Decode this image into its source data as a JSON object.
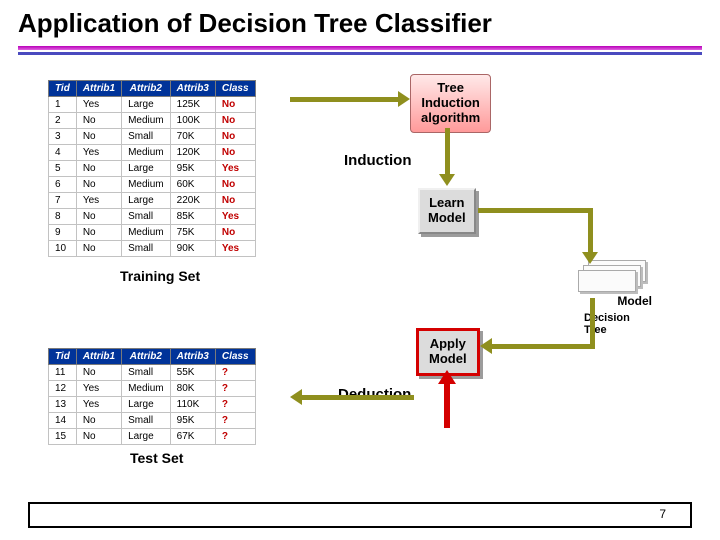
{
  "title": "Application of Decision Tree Classifier",
  "training": {
    "label": "Training Set",
    "headers": [
      "Tid",
      "Attrib1",
      "Attrib2",
      "Attrib3",
      "Class"
    ],
    "rows": [
      {
        "tid": "1",
        "a1": "Yes",
        "a2": "Large",
        "a3": "125K",
        "cls": "No"
      },
      {
        "tid": "2",
        "a1": "No",
        "a2": "Medium",
        "a3": "100K",
        "cls": "No"
      },
      {
        "tid": "3",
        "a1": "No",
        "a2": "Small",
        "a3": "70K",
        "cls": "No"
      },
      {
        "tid": "4",
        "a1": "Yes",
        "a2": "Medium",
        "a3": "120K",
        "cls": "No"
      },
      {
        "tid": "5",
        "a1": "No",
        "a2": "Large",
        "a3": "95K",
        "cls": "Yes"
      },
      {
        "tid": "6",
        "a1": "No",
        "a2": "Medium",
        "a3": "60K",
        "cls": "No"
      },
      {
        "tid": "7",
        "a1": "Yes",
        "a2": "Large",
        "a3": "220K",
        "cls": "No"
      },
      {
        "tid": "8",
        "a1": "No",
        "a2": "Small",
        "a3": "85K",
        "cls": "Yes"
      },
      {
        "tid": "9",
        "a1": "No",
        "a2": "Medium",
        "a3": "75K",
        "cls": "No"
      },
      {
        "tid": "10",
        "a1": "No",
        "a2": "Small",
        "a3": "90K",
        "cls": "Yes"
      }
    ]
  },
  "test": {
    "label": "Test Set",
    "headers": [
      "Tid",
      "Attrib1",
      "Attrib2",
      "Attrib3",
      "Class"
    ],
    "rows": [
      {
        "tid": "11",
        "a1": "No",
        "a2": "Small",
        "a3": "55K",
        "cls": "?"
      },
      {
        "tid": "12",
        "a1": "Yes",
        "a2": "Medium",
        "a3": "80K",
        "cls": "?"
      },
      {
        "tid": "13",
        "a1": "Yes",
        "a2": "Large",
        "a3": "110K",
        "cls": "?"
      },
      {
        "tid": "14",
        "a1": "No",
        "a2": "Small",
        "a3": "95K",
        "cls": "?"
      },
      {
        "tid": "15",
        "a1": "No",
        "a2": "Large",
        "a3": "67K",
        "cls": "?"
      }
    ]
  },
  "blocks": {
    "tree_induction_l1": "Tree",
    "tree_induction_l2": "Induction",
    "tree_induction_l3": "algorithm",
    "learn_l1": "Learn",
    "learn_l2": "Model",
    "apply_l1": "Apply",
    "apply_l2": "Model",
    "model_label": "Model"
  },
  "phases": {
    "induction": "Induction",
    "deduction": "Deduction"
  },
  "annotation": "Decision\nTree",
  "page": "7"
}
